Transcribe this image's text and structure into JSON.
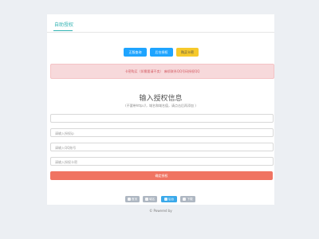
{
  "header": {
    "tab_title": "自助授权"
  },
  "actions": {
    "buttons": [
      {
        "label": "正版查询",
        "color": "#1ea4ff"
      },
      {
        "label": "后台授权",
        "color": "#1ea4ff"
      },
      {
        "label": "购买卡密",
        "color": "#f6c92b"
      }
    ]
  },
  "alert": {
    "text": "卡密购买（如需要请不卖）   麻烦联系QQ号码授权QQ"
  },
  "form": {
    "title": "输入授权信息",
    "subtitle": "(不要带http://，域名和域名值，请点击后再添加 )",
    "fields": [
      {
        "placeholder": "",
        "value": ""
      },
      {
        "placeholder": "请输入授权ip",
        "value": ""
      },
      {
        "placeholder": "请输入QQ账号",
        "value": ""
      },
      {
        "placeholder": "请输入授权卡密",
        "value": ""
      }
    ],
    "submit_label": "确定授权"
  },
  "bottom_actions": {
    "buttons": [
      {
        "label": "首页",
        "icon": "home-icon",
        "color": "#aeb7c2"
      },
      {
        "label": "域名",
        "icon": "link-icon",
        "color": "#aeb7c2"
      },
      {
        "label": "后台",
        "icon": "user-icon",
        "color": "#3aa9ea"
      },
      {
        "label": "下载",
        "icon": "download-icon",
        "color": "#aeb7c2"
      }
    ]
  },
  "footer": {
    "text": "© Powered by"
  }
}
